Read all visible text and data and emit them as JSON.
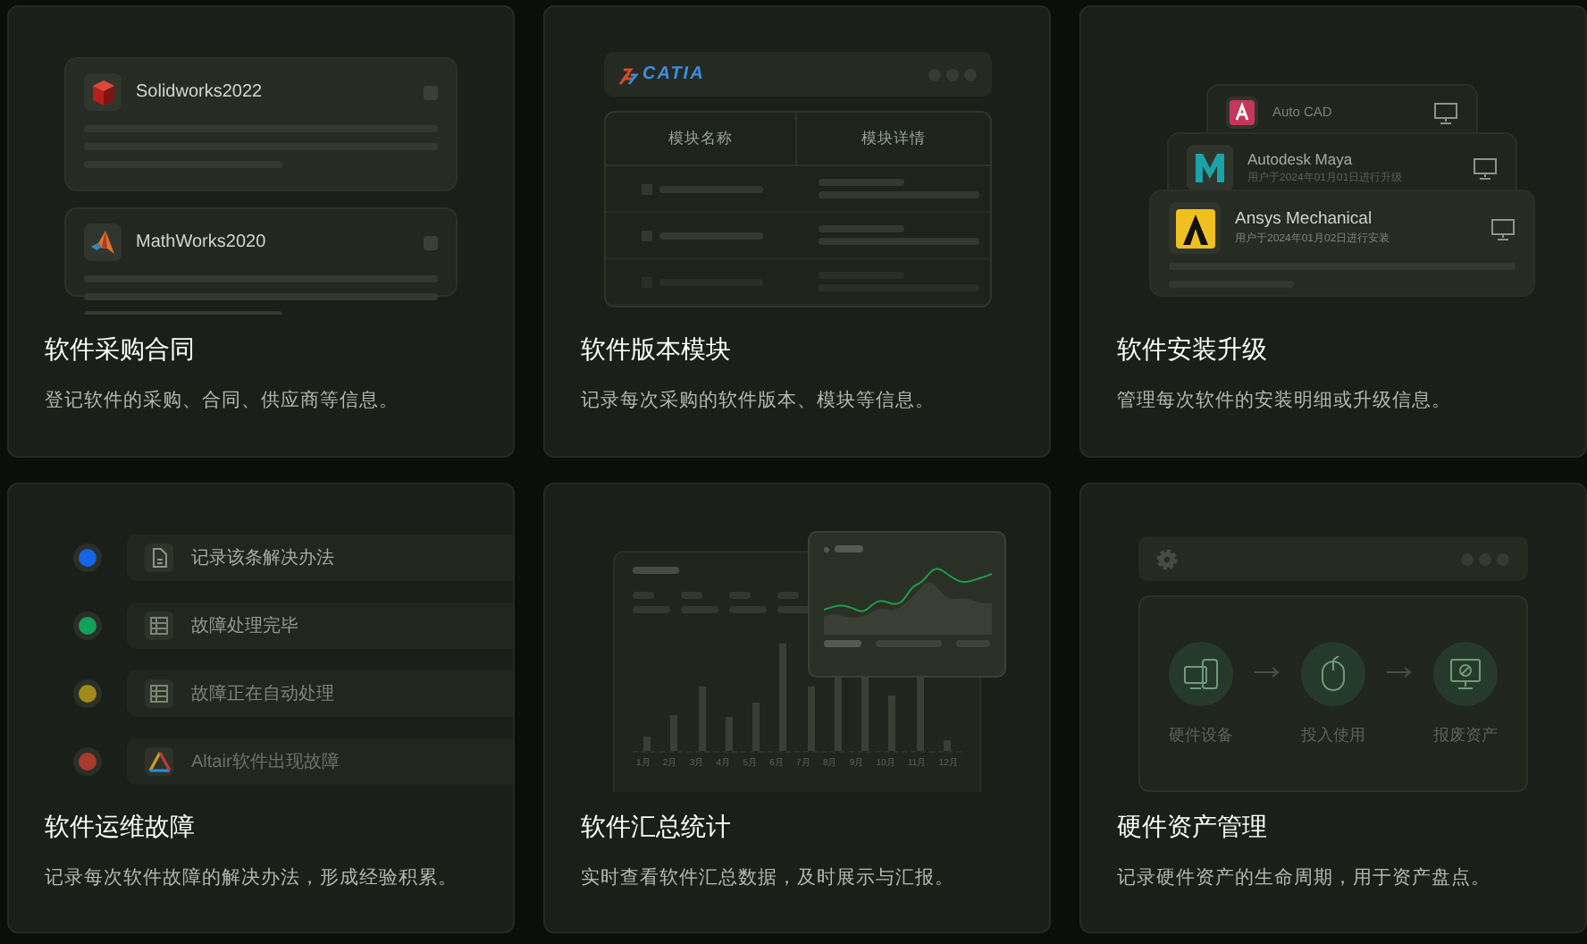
{
  "cards": [
    {
      "kind": "purchase",
      "title": "软件采购合同",
      "description": "登记软件的采购、合同、供应商等信息。",
      "items": [
        {
          "name": "Solidworks2022",
          "checked": false
        },
        {
          "name": "MathWorks2020",
          "checked": false
        }
      ]
    },
    {
      "kind": "modules",
      "title": "软件版本模块",
      "description": "记录每次采购的软件版本、模块等信息。",
      "brand": "CATIA",
      "columns": [
        "模块名称",
        "模块详情"
      ]
    },
    {
      "kind": "installs",
      "title": "软件安装升级",
      "description": "管理每次软件的安装明细或升级信息。",
      "items": [
        {
          "name": "Auto CAD"
        },
        {
          "name": "Autodesk Maya",
          "note": "用户于2024年01月01日进行升级"
        },
        {
          "name": "Ansys Mechanical",
          "note": "用户于2024年01月02日进行安装"
        }
      ]
    },
    {
      "kind": "timeline",
      "title": "软件运维故障",
      "description": "记录每次软件故障的解决办法，形成经验积累。",
      "steps": [
        {
          "label": "记录该条解决办法",
          "color": "#1565e6"
        },
        {
          "label": "故障处理完毕",
          "color": "#14a05a"
        },
        {
          "label": "故障正在自动处理",
          "color": "#a08a1e"
        },
        {
          "label": "Altair软件出现故障",
          "color": "#a83a2e"
        }
      ]
    },
    {
      "kind": "stats",
      "title": "软件汇总统计",
      "description": "实时查看软件汇总数据，及时展示与汇报。",
      "months": [
        "1月",
        "2月",
        "3月",
        "4月",
        "5月",
        "6月",
        "7月",
        "8月",
        "9月",
        "10月",
        "11月",
        "12月"
      ]
    },
    {
      "kind": "lifecycle",
      "title": "硬件资产管理",
      "description": "记录硬件资产的生命周期，用于资产盘点。",
      "steps": [
        {
          "label": "硬件设备"
        },
        {
          "label": "投入使用"
        },
        {
          "label": "报废资产"
        }
      ]
    }
  ]
}
